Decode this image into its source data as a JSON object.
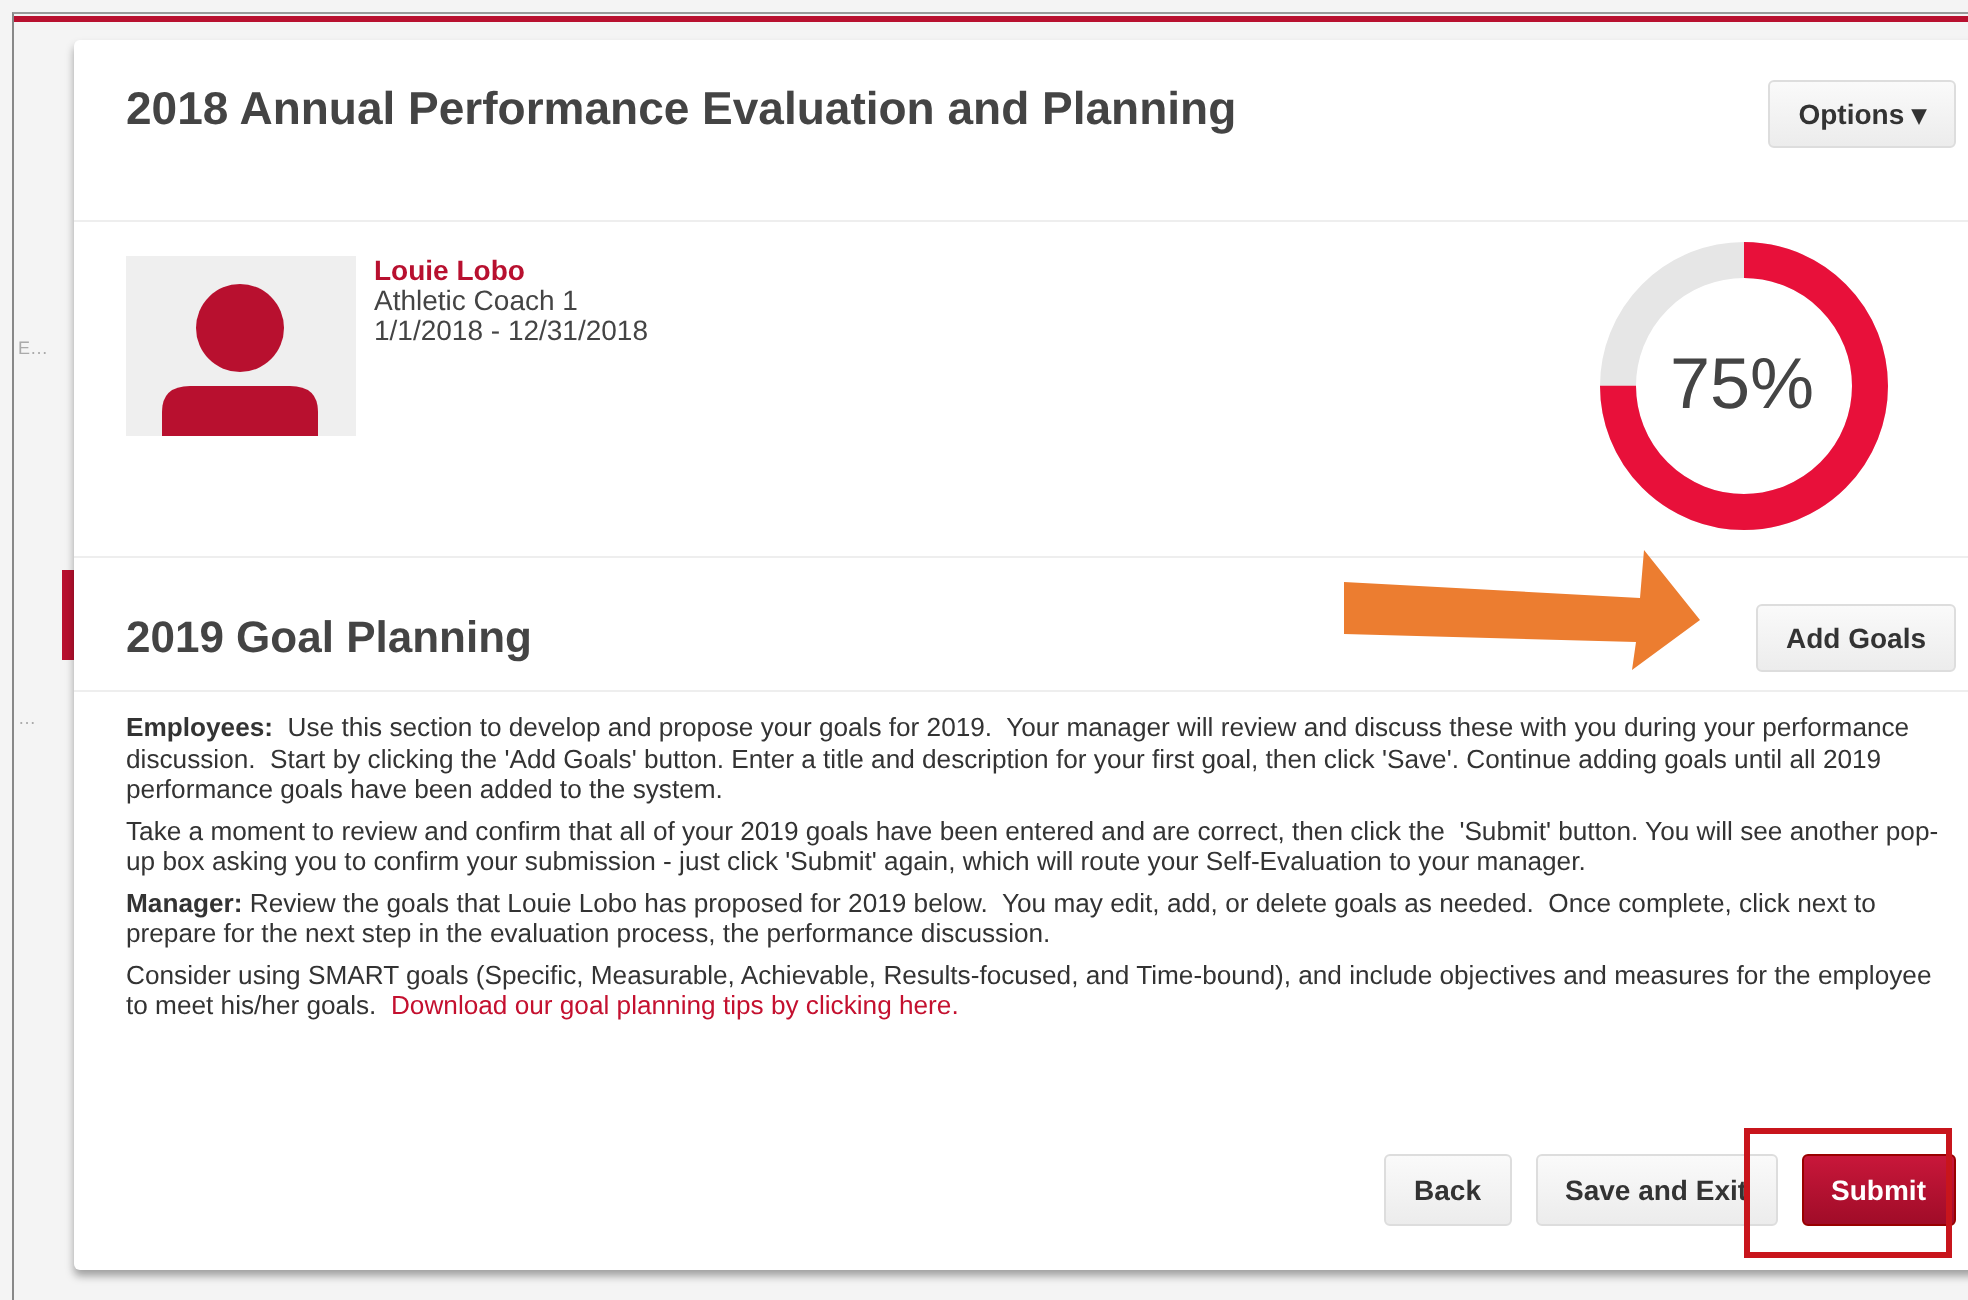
{
  "sidebar": {
    "items": [
      {
        "label": "E…"
      },
      {
        "label": "…"
      }
    ]
  },
  "header": {
    "title": "2018 Annual Performance Evaluation and Planning",
    "options_button": "Options ▾"
  },
  "profile": {
    "name": "Louie Lobo",
    "job_title": "Athletic Coach 1",
    "period": "1/1/2018 - 12/31/2018",
    "progress": {
      "level": 0.75,
      "reading": "75%"
    }
  },
  "goal_planning": {
    "title": "2019 Goal Planning",
    "add_button": "Add Goals",
    "paragraphs": [
      {
        "text": "**Employees:**  Use this section to develop and propose your goals for 2019.  Your manager will review and discuss these with you during your performance discussion.  Start by clicking the 'Add Goals' button. Enter a title and description for your first goal, then click 'Save'. Continue adding goals until all 2019 performance goals have been added to the system."
      },
      {
        "text": "Take a moment to review and confirm that all of your 2019 goals have been entered and are correct, then click the  'Submit' button. You will see another pop-up box asking you to confirm your submission - just click 'Submit' again, which will route your Self-Evaluation to your manager."
      },
      {
        "text": "**Manager:** Review the goals that Louie Lobo has proposed for 2019 below.  You may edit, add, or delete goals as needed.  Once complete, click next to prepare for the next step in the evaluation process, the performance discussion."
      },
      {
        "text": "Consider using SMART goals (Specific, Measurable, Achievable, Results-focused, and Time-bound), and include objectives and measures for the employee to meet his/her goals.",
        "link": "Download our goal planning tips by clicking here."
      }
    ]
  },
  "footer_buttons": [
    {
      "label": "Back",
      "kind": "plain"
    },
    {
      "label": "Save and Exit",
      "kind": "plain"
    },
    {
      "label": "Submit",
      "kind": "primary"
    }
  ]
}
